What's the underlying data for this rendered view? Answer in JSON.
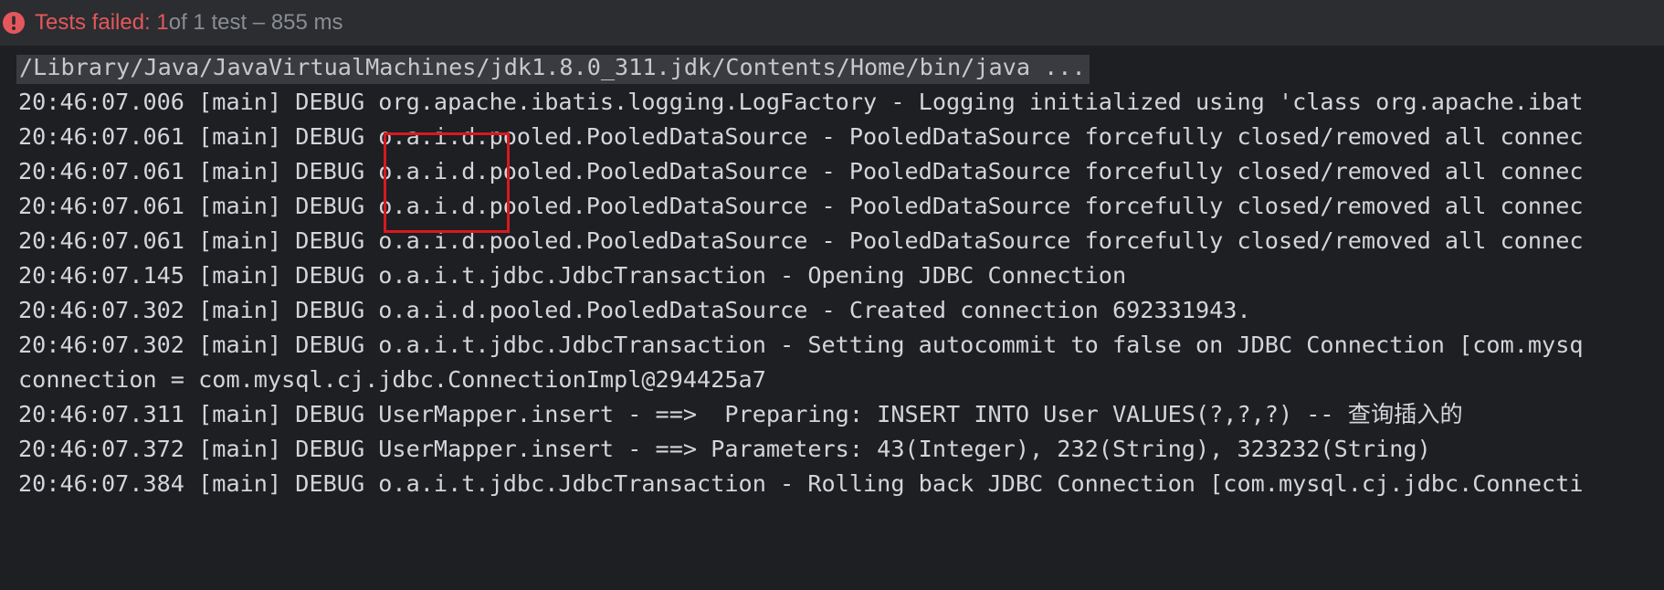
{
  "status": {
    "failed_label": "Tests failed: 1",
    "summary": " of 1 test – 855 ms",
    "icon": "error-icon",
    "colors": {
      "failed": "#e5575c",
      "muted": "#8a8d93"
    }
  },
  "console": {
    "command": "/Library/Java/JavaVirtualMachines/jdk1.8.0_311.jdk/Contents/Home/bin/java ...",
    "lines": [
      "20:46:07.006 [main] DEBUG org.apache.ibatis.logging.LogFactory - Logging initialized using 'class org.apache.ibat",
      "20:46:07.061 [main] DEBUG o.a.i.d.pooled.PooledDataSource - PooledDataSource forcefully closed/removed all connec",
      "20:46:07.061 [main] DEBUG o.a.i.d.pooled.PooledDataSource - PooledDataSource forcefully closed/removed all connec",
      "20:46:07.061 [main] DEBUG o.a.i.d.pooled.PooledDataSource - PooledDataSource forcefully closed/removed all connec",
      "20:46:07.061 [main] DEBUG o.a.i.d.pooled.PooledDataSource - PooledDataSource forcefully closed/removed all connec",
      "20:46:07.145 [main] DEBUG o.a.i.t.jdbc.JdbcTransaction - Opening JDBC Connection",
      "20:46:07.302 [main] DEBUG o.a.i.d.pooled.PooledDataSource - Created connection 692331943.",
      "20:46:07.302 [main] DEBUG o.a.i.t.jdbc.JdbcTransaction - Setting autocommit to false on JDBC Connection [com.mysq",
      "connection = com.mysql.cj.jdbc.ConnectionImpl@294425a7",
      "20:46:07.311 [main] DEBUG UserMapper.insert - ==>  Preparing: INSERT INTO User VALUES(?,?,?) -- 查询插入的",
      "20:46:07.372 [main] DEBUG UserMapper.insert - ==> Parameters: 43(Integer), 232(String), 323232(String)",
      "20:46:07.384 [main] DEBUG o.a.i.t.jdbc.JdbcTransaction - Rolling back JDBC Connection [com.mysql.cj.jdbc.Connecti"
    ]
  }
}
